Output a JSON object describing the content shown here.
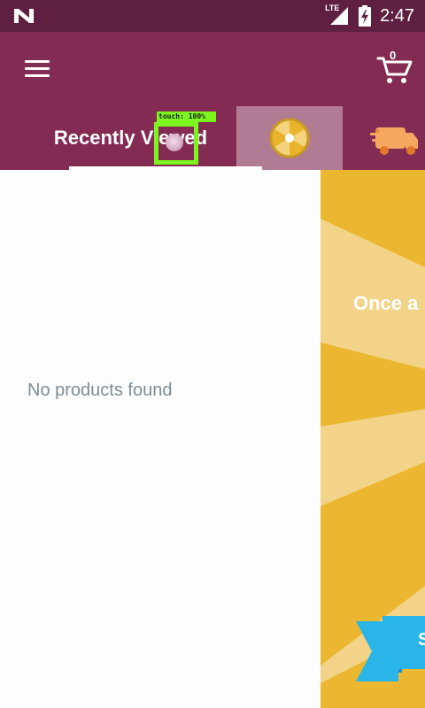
{
  "status_bar": {
    "network": "LTE",
    "time": "2:47"
  },
  "app_bar": {
    "cart_count": "0"
  },
  "tabs": {
    "recent_label": "Recently Viewed",
    "wheel_icon": "wheel-icon",
    "truck_icon": "delivery-truck-icon"
  },
  "touch_overlay": {
    "label": "touch: 100%"
  },
  "recently_viewed": {
    "empty_message": "No products found"
  },
  "promo": {
    "headline_fragment": "Once a",
    "banner_fragment": "S"
  },
  "colors": {
    "status_bar": "#5f1f40",
    "app_bar": "#842b53",
    "active_tab_bg": "#b07b93",
    "promo_yellow": "#ecb730",
    "promo_light": "#f2d387",
    "promo_ribbon": "#29b5e8",
    "touch_marker": "#7cf51f",
    "empty_text": "#7c8d98"
  }
}
